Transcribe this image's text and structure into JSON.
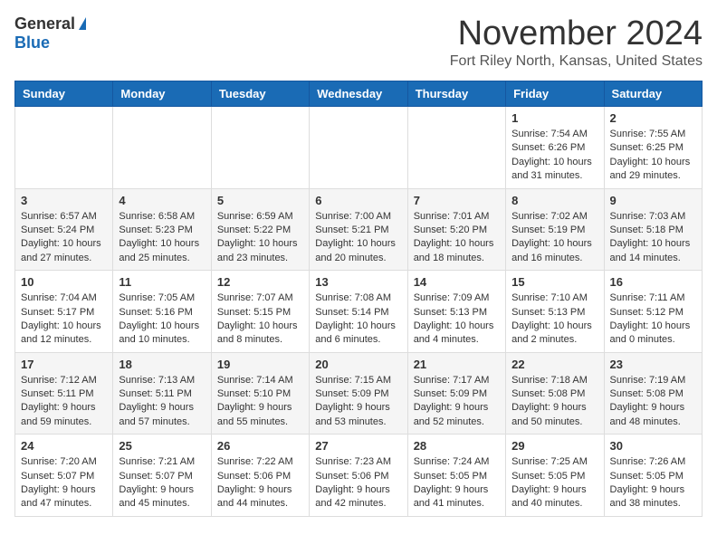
{
  "logo": {
    "general": "General",
    "blue": "Blue"
  },
  "header": {
    "month": "November 2024",
    "location": "Fort Riley North, Kansas, United States"
  },
  "weekdays": [
    "Sunday",
    "Monday",
    "Tuesday",
    "Wednesday",
    "Thursday",
    "Friday",
    "Saturday"
  ],
  "weeks": [
    [
      {
        "day": "",
        "info": ""
      },
      {
        "day": "",
        "info": ""
      },
      {
        "day": "",
        "info": ""
      },
      {
        "day": "",
        "info": ""
      },
      {
        "day": "",
        "info": ""
      },
      {
        "day": "1",
        "info": "Sunrise: 7:54 AM\nSunset: 6:26 PM\nDaylight: 10 hours\nand 31 minutes."
      },
      {
        "day": "2",
        "info": "Sunrise: 7:55 AM\nSunset: 6:25 PM\nDaylight: 10 hours\nand 29 minutes."
      }
    ],
    [
      {
        "day": "3",
        "info": "Sunrise: 6:57 AM\nSunset: 5:24 PM\nDaylight: 10 hours\nand 27 minutes."
      },
      {
        "day": "4",
        "info": "Sunrise: 6:58 AM\nSunset: 5:23 PM\nDaylight: 10 hours\nand 25 minutes."
      },
      {
        "day": "5",
        "info": "Sunrise: 6:59 AM\nSunset: 5:22 PM\nDaylight: 10 hours\nand 23 minutes."
      },
      {
        "day": "6",
        "info": "Sunrise: 7:00 AM\nSunset: 5:21 PM\nDaylight: 10 hours\nand 20 minutes."
      },
      {
        "day": "7",
        "info": "Sunrise: 7:01 AM\nSunset: 5:20 PM\nDaylight: 10 hours\nand 18 minutes."
      },
      {
        "day": "8",
        "info": "Sunrise: 7:02 AM\nSunset: 5:19 PM\nDaylight: 10 hours\nand 16 minutes."
      },
      {
        "day": "9",
        "info": "Sunrise: 7:03 AM\nSunset: 5:18 PM\nDaylight: 10 hours\nand 14 minutes."
      }
    ],
    [
      {
        "day": "10",
        "info": "Sunrise: 7:04 AM\nSunset: 5:17 PM\nDaylight: 10 hours\nand 12 minutes."
      },
      {
        "day": "11",
        "info": "Sunrise: 7:05 AM\nSunset: 5:16 PM\nDaylight: 10 hours\nand 10 minutes."
      },
      {
        "day": "12",
        "info": "Sunrise: 7:07 AM\nSunset: 5:15 PM\nDaylight: 10 hours\nand 8 minutes."
      },
      {
        "day": "13",
        "info": "Sunrise: 7:08 AM\nSunset: 5:14 PM\nDaylight: 10 hours\nand 6 minutes."
      },
      {
        "day": "14",
        "info": "Sunrise: 7:09 AM\nSunset: 5:13 PM\nDaylight: 10 hours\nand 4 minutes."
      },
      {
        "day": "15",
        "info": "Sunrise: 7:10 AM\nSunset: 5:13 PM\nDaylight: 10 hours\nand 2 minutes."
      },
      {
        "day": "16",
        "info": "Sunrise: 7:11 AM\nSunset: 5:12 PM\nDaylight: 10 hours\nand 0 minutes."
      }
    ],
    [
      {
        "day": "17",
        "info": "Sunrise: 7:12 AM\nSunset: 5:11 PM\nDaylight: 9 hours\nand 59 minutes."
      },
      {
        "day": "18",
        "info": "Sunrise: 7:13 AM\nSunset: 5:11 PM\nDaylight: 9 hours\nand 57 minutes."
      },
      {
        "day": "19",
        "info": "Sunrise: 7:14 AM\nSunset: 5:10 PM\nDaylight: 9 hours\nand 55 minutes."
      },
      {
        "day": "20",
        "info": "Sunrise: 7:15 AM\nSunset: 5:09 PM\nDaylight: 9 hours\nand 53 minutes."
      },
      {
        "day": "21",
        "info": "Sunrise: 7:17 AM\nSunset: 5:09 PM\nDaylight: 9 hours\nand 52 minutes."
      },
      {
        "day": "22",
        "info": "Sunrise: 7:18 AM\nSunset: 5:08 PM\nDaylight: 9 hours\nand 50 minutes."
      },
      {
        "day": "23",
        "info": "Sunrise: 7:19 AM\nSunset: 5:08 PM\nDaylight: 9 hours\nand 48 minutes."
      }
    ],
    [
      {
        "day": "24",
        "info": "Sunrise: 7:20 AM\nSunset: 5:07 PM\nDaylight: 9 hours\nand 47 minutes."
      },
      {
        "day": "25",
        "info": "Sunrise: 7:21 AM\nSunset: 5:07 PM\nDaylight: 9 hours\nand 45 minutes."
      },
      {
        "day": "26",
        "info": "Sunrise: 7:22 AM\nSunset: 5:06 PM\nDaylight: 9 hours\nand 44 minutes."
      },
      {
        "day": "27",
        "info": "Sunrise: 7:23 AM\nSunset: 5:06 PM\nDaylight: 9 hours\nand 42 minutes."
      },
      {
        "day": "28",
        "info": "Sunrise: 7:24 AM\nSunset: 5:05 PM\nDaylight: 9 hours\nand 41 minutes."
      },
      {
        "day": "29",
        "info": "Sunrise: 7:25 AM\nSunset: 5:05 PM\nDaylight: 9 hours\nand 40 minutes."
      },
      {
        "day": "30",
        "info": "Sunrise: 7:26 AM\nSunset: 5:05 PM\nDaylight: 9 hours\nand 38 minutes."
      }
    ]
  ]
}
